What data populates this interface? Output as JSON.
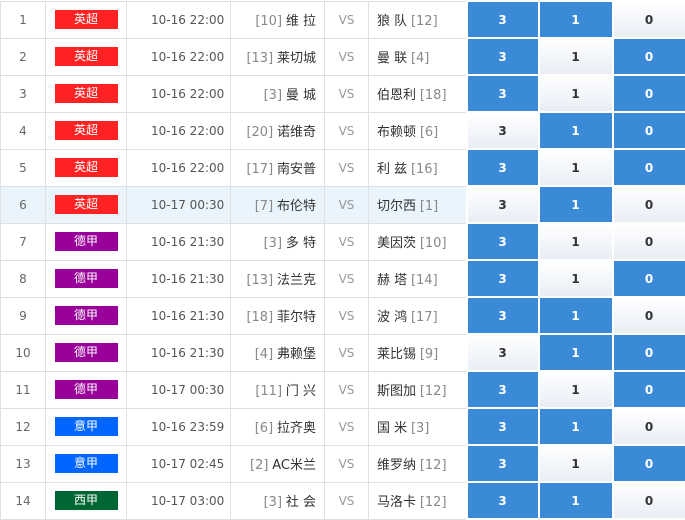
{
  "rows": [
    {
      "no": "1",
      "league": "英超",
      "league_color": "#ff2222",
      "time": "10-16 22:00",
      "home_rank": "[10]",
      "home": "维 拉",
      "vs": "VS",
      "away": "狼 队",
      "away_rank": "[12]",
      "c3": "3",
      "c1": "1",
      "c0": "0",
      "sel": [
        true,
        true,
        false
      ]
    },
    {
      "no": "2",
      "league": "英超",
      "league_color": "#ff2222",
      "time": "10-16 22:00",
      "home_rank": "[13]",
      "home": "莱切城",
      "vs": "VS",
      "away": "曼 联",
      "away_rank": "[4]",
      "c3": "3",
      "c1": "1",
      "c0": "0",
      "sel": [
        true,
        false,
        true
      ]
    },
    {
      "no": "3",
      "league": "英超",
      "league_color": "#ff2222",
      "time": "10-16 22:00",
      "home_rank": "[3]",
      "home": "曼 城",
      "vs": "VS",
      "away": "伯恩利",
      "away_rank": "[18]",
      "c3": "3",
      "c1": "1",
      "c0": "0",
      "sel": [
        true,
        false,
        true
      ]
    },
    {
      "no": "4",
      "league": "英超",
      "league_color": "#ff2222",
      "time": "10-16 22:00",
      "home_rank": "[20]",
      "home": "诺维奇",
      "vs": "VS",
      "away": "布赖顿",
      "away_rank": "[6]",
      "c3": "3",
      "c1": "1",
      "c0": "0",
      "sel": [
        false,
        true,
        true
      ]
    },
    {
      "no": "5",
      "league": "英超",
      "league_color": "#ff2222",
      "time": "10-16 22:00",
      "home_rank": "[17]",
      "home": "南安普",
      "vs": "VS",
      "away": "利 兹",
      "away_rank": "[16]",
      "c3": "3",
      "c1": "1",
      "c0": "0",
      "sel": [
        true,
        false,
        true
      ]
    },
    {
      "no": "6",
      "league": "英超",
      "league_color": "#ff2222",
      "time": "10-17 00:30",
      "home_rank": "[7]",
      "home": "布伦特",
      "vs": "VS",
      "away": "切尔西",
      "away_rank": "[1]",
      "c3": "3",
      "c1": "1",
      "c0": "0",
      "sel": [
        false,
        true,
        false
      ]
    },
    {
      "no": "7",
      "league": "德甲",
      "league_color": "#990099",
      "time": "10-16 21:30",
      "home_rank": "[3]",
      "home": "多 特",
      "vs": "VS",
      "away": "美因茨",
      "away_rank": "[10]",
      "c3": "3",
      "c1": "1",
      "c0": "0",
      "sel": [
        true,
        false,
        false
      ]
    },
    {
      "no": "8",
      "league": "德甲",
      "league_color": "#990099",
      "time": "10-16 21:30",
      "home_rank": "[13]",
      "home": "法兰克",
      "vs": "VS",
      "away": "赫 塔",
      "away_rank": "[14]",
      "c3": "3",
      "c1": "1",
      "c0": "0",
      "sel": [
        true,
        false,
        true
      ]
    },
    {
      "no": "9",
      "league": "德甲",
      "league_color": "#990099",
      "time": "10-16 21:30",
      "home_rank": "[18]",
      "home": "菲尔特",
      "vs": "VS",
      "away": "波 鸿",
      "away_rank": "[17]",
      "c3": "3",
      "c1": "1",
      "c0": "0",
      "sel": [
        true,
        true,
        false
      ]
    },
    {
      "no": "10",
      "league": "德甲",
      "league_color": "#990099",
      "time": "10-16 21:30",
      "home_rank": "[4]",
      "home": "弗赖堡",
      "vs": "VS",
      "away": "莱比锡",
      "away_rank": "[9]",
      "c3": "3",
      "c1": "1",
      "c0": "0",
      "sel": [
        false,
        true,
        true
      ]
    },
    {
      "no": "11",
      "league": "德甲",
      "league_color": "#990099",
      "time": "10-17 00:30",
      "home_rank": "[11]",
      "home": "门 兴",
      "vs": "VS",
      "away": "斯图加",
      "away_rank": "[12]",
      "c3": "3",
      "c1": "1",
      "c0": "0",
      "sel": [
        true,
        false,
        true
      ]
    },
    {
      "no": "12",
      "league": "意甲",
      "league_color": "#0066ff",
      "time": "10-16 23:59",
      "home_rank": "[6]",
      "home": "拉齐奥",
      "vs": "VS",
      "away": "国 米",
      "away_rank": "[3]",
      "c3": "3",
      "c1": "1",
      "c0": "0",
      "sel": [
        true,
        true,
        false
      ]
    },
    {
      "no": "13",
      "league": "意甲",
      "league_color": "#0066ff",
      "time": "10-17 02:45",
      "home_rank": "[2]",
      "home": "AC米兰",
      "vs": "VS",
      "away": "维罗纳",
      "away_rank": "[12]",
      "c3": "3",
      "c1": "1",
      "c0": "0",
      "sel": [
        true,
        false,
        true
      ]
    },
    {
      "no": "14",
      "league": "西甲",
      "league_color": "#006633",
      "time": "10-17 03:00",
      "home_rank": "[3]",
      "home": "社 会",
      "vs": "VS",
      "away": "马洛卡",
      "away_rank": "[12]",
      "c3": "3",
      "c1": "1",
      "c0": "0",
      "sel": [
        true,
        true,
        false
      ]
    }
  ]
}
